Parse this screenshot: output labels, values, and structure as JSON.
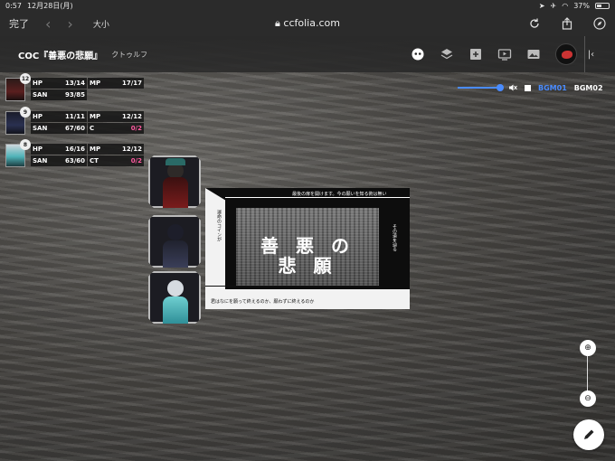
{
  "status": {
    "time": "0:57",
    "date": "12月28日(月)",
    "battery": "37%"
  },
  "browser": {
    "done": "完了",
    "aa": "大小",
    "url": "ccfolia.com"
  },
  "room": {
    "title": "COC『善悪の悲願』",
    "subtitle": "クトゥルフ"
  },
  "bgm": {
    "bgm1": "BGM01",
    "bgm2": "BGM02",
    "volume": 1.0
  },
  "characters": [
    {
      "badge": "12",
      "stats": [
        {
          "label": "HP",
          "value": "13/14"
        },
        {
          "label": "MP",
          "value": "17/17"
        },
        {
          "label": "SAN",
          "value": "93/85"
        }
      ]
    },
    {
      "badge": "9",
      "stats": [
        {
          "label": "HP",
          "value": "11/11"
        },
        {
          "label": "MP",
          "value": "12/12"
        },
        {
          "label": "SAN",
          "value": "67/60"
        },
        {
          "label": "C",
          "value": "0/2"
        }
      ]
    },
    {
      "badge": "8",
      "stats": [
        {
          "label": "HP",
          "value": "16/16"
        },
        {
          "label": "MP",
          "value": "12/12"
        },
        {
          "label": "SAN",
          "value": "63/60"
        },
        {
          "label": "CT",
          "value": "0/2"
        }
      ]
    }
  ],
  "card": {
    "title_line1": "善 悪 の",
    "title_line2": "悲 願",
    "top_text": "最後の扉を開けます。今の願いを知る術は無い",
    "bottom_text": "君はなにを願って終えるのか、願わずに終えるのか",
    "left_vertical": "運命のコインが",
    "right_vertical": "その道を辿る"
  },
  "colors": {
    "accent": "#4a8cff",
    "pink": "#ff5aa0"
  }
}
